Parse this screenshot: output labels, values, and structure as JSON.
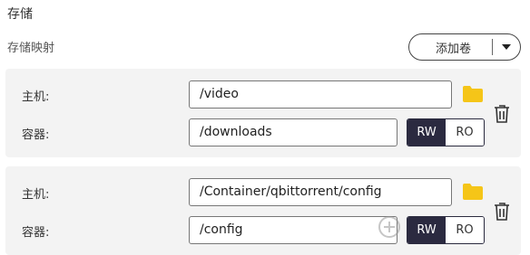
{
  "section_title": "存储",
  "sub_title": "存储映射",
  "add_volume": {
    "label": "添加卷"
  },
  "mappings": [
    {
      "host_label": "主机:",
      "host_path": "/video",
      "container_label": "容器:",
      "container_path": "/downloads",
      "rw_label": "RW",
      "ro_label": "RO",
      "mode": "RW"
    },
    {
      "host_label": "主机:",
      "host_path": "/Container/qbittorrent/config",
      "container_label": "容器:",
      "container_path": "/config",
      "rw_label": "RW",
      "ro_label": "RO",
      "mode": "RW"
    }
  ],
  "colors": {
    "active_mode_bg": "#2b2a40",
    "folder": "#f5c518",
    "card_bg": "#f3f3f3"
  },
  "icons": {
    "folder": "folder-icon",
    "delete": "trash-icon",
    "dropdown": "caret-down-icon"
  }
}
